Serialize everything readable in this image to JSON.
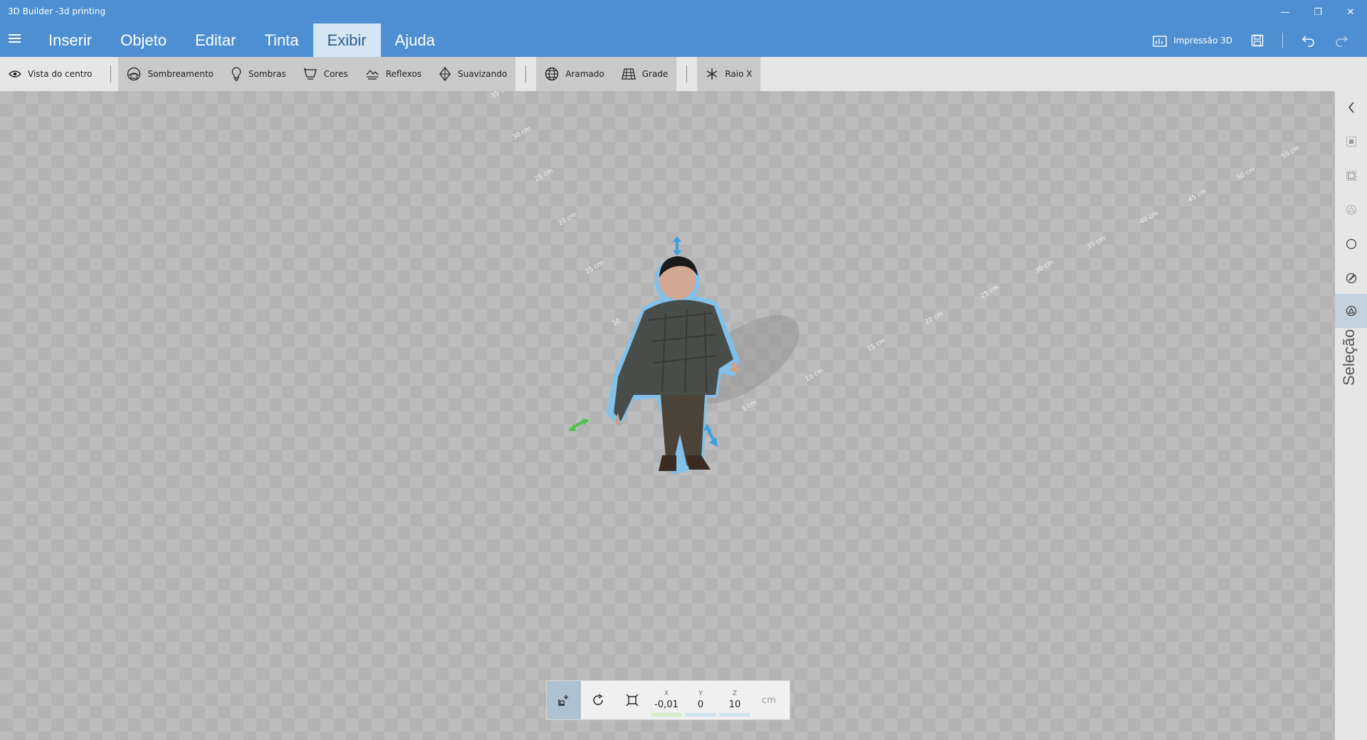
{
  "window": {
    "title": "3D Builder -3d printing",
    "minimize_glyph": "—",
    "restore_glyph": "❐",
    "close_glyph": "✕"
  },
  "menu": {
    "items": [
      "Inserir",
      "Objeto",
      "Editar",
      "Tinta",
      "Exibir",
      "Ajuda"
    ],
    "active": "Exibir"
  },
  "title_actions": {
    "print_label": "Impressão 3D"
  },
  "toolbar": {
    "center_view": "Vista do centro",
    "shading": "Sombreamento",
    "shadows": "Sombras",
    "colors": "Cores",
    "reflections": "Reflexos",
    "smoothing": "Suavizando",
    "wireframe": "Aramado",
    "grid": "Grade",
    "xray": "Raio X"
  },
  "ruler_labels": {
    "left": [
      "35 cm",
      "30 cm",
      "25 cm",
      "20 cm",
      "15 cm",
      "10"
    ],
    "right": [
      "0",
      "5 cm",
      "10 cm",
      "15 cm",
      "20 cm",
      "25 cm",
      "30 cm",
      "35 cm",
      "40 cm",
      "45 cm",
      "50 cm",
      "55 cm"
    ]
  },
  "right_panel": {
    "label": "Seleção"
  },
  "transform": {
    "x_label": "X",
    "y_label": "Y",
    "z_label": "Z",
    "x": "-0,01",
    "y": "0",
    "z": "10",
    "unit": "cm"
  },
  "colors": {
    "titlebar": "#4d8fd1",
    "selection_glow": "#7cc3f0",
    "axis_green": "#4ec24e",
    "axis_blue": "#3aa0e0"
  }
}
